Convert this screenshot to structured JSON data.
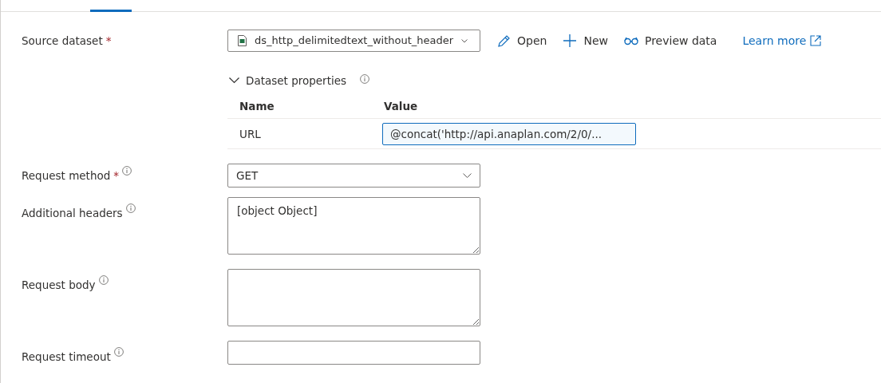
{
  "tabs": [
    {
      "selected": true
    }
  ],
  "source_dataset": {
    "label": "Source dataset",
    "required_mark": "*",
    "value": "ds_http_delimitedtext_without_header",
    "actions": [
      {
        "kind": "open",
        "label": "Open"
      },
      {
        "kind": "new",
        "label": "New"
      },
      {
        "kind": "preview",
        "label": "Preview data"
      }
    ],
    "learn_more": "Learn more"
  },
  "dataset_properties": {
    "title": "Dataset properties",
    "expanded": true,
    "columns": [
      "Name",
      "Value"
    ],
    "rows": [
      {
        "name": "URL",
        "value": "@concat('http://api.anaplan.com/2/0/..."
      }
    ]
  },
  "fields": [
    {
      "kind": "select",
      "label": "Request method",
      "required_mark": "*",
      "info": true,
      "value": "GET"
    },
    {
      "kind": "textarea",
      "label": "Additional headers",
      "info": true,
      "value": "[object Object]"
    },
    {
      "kind": "textarea",
      "label": "Request body",
      "info": true
    },
    {
      "kind": "input",
      "label": "Request timeout",
      "info": true
    }
  ]
}
